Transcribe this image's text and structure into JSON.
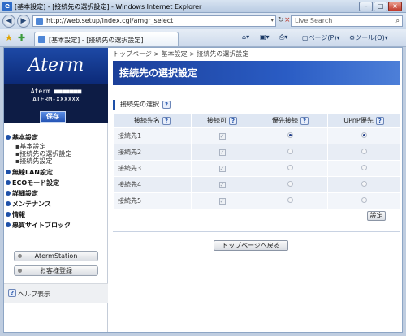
{
  "window": {
    "title": "[基本設定] - [接続先の選択設定] - Windows Internet Explorer"
  },
  "toolbar": {
    "url": "http://web.setup/index.cgi/amgr_select",
    "search_placeholder": "Live Search",
    "tab_title": "[基本設定] - [接続先の選択設定]",
    "page_menu": "ページ(P)",
    "tools_menu": "ツール(O)"
  },
  "sidebar": {
    "logo": "Aterm",
    "model_line1": "Aterm ■■■■■■■",
    "model_line2": "ATERM-XXXXXX",
    "save": "保存",
    "menu": [
      {
        "label": "基本設定",
        "subs": [
          "基本設定",
          "接続先の選択設定",
          "接続先設定"
        ]
      },
      {
        "label": "無線LAN設定",
        "subs": []
      },
      {
        "label": "ECOモード設定",
        "subs": []
      },
      {
        "label": "詳細設定",
        "subs": []
      },
      {
        "label": "メンテナンス",
        "subs": []
      },
      {
        "label": "情報",
        "subs": []
      },
      {
        "label": "悪質サイトブロック",
        "subs": []
      }
    ],
    "btn_station": "AtermStation",
    "btn_register": "お客様登録",
    "help": "ヘルプ表示"
  },
  "main": {
    "breadcrumb": "トップページ > 基本設定 > 接続先の選択設定",
    "heading": "接続先の選択設定",
    "section": "接続先の選択",
    "columns": [
      "接続先名",
      "接続可",
      "優先接続",
      "UPnP優先"
    ],
    "rows": [
      {
        "name": "接続先1",
        "enabled": true,
        "priority": true,
        "upnp": true
      },
      {
        "name": "接続先2",
        "enabled": false,
        "priority": false,
        "upnp": false
      },
      {
        "name": "接続先3",
        "enabled": false,
        "priority": false,
        "upnp": false
      },
      {
        "name": "接続先4",
        "enabled": false,
        "priority": false,
        "upnp": false
      },
      {
        "name": "接続先5",
        "enabled": false,
        "priority": false,
        "upnp": false
      }
    ],
    "set_button": "設定",
    "top_button": "トップページへ戻る"
  }
}
